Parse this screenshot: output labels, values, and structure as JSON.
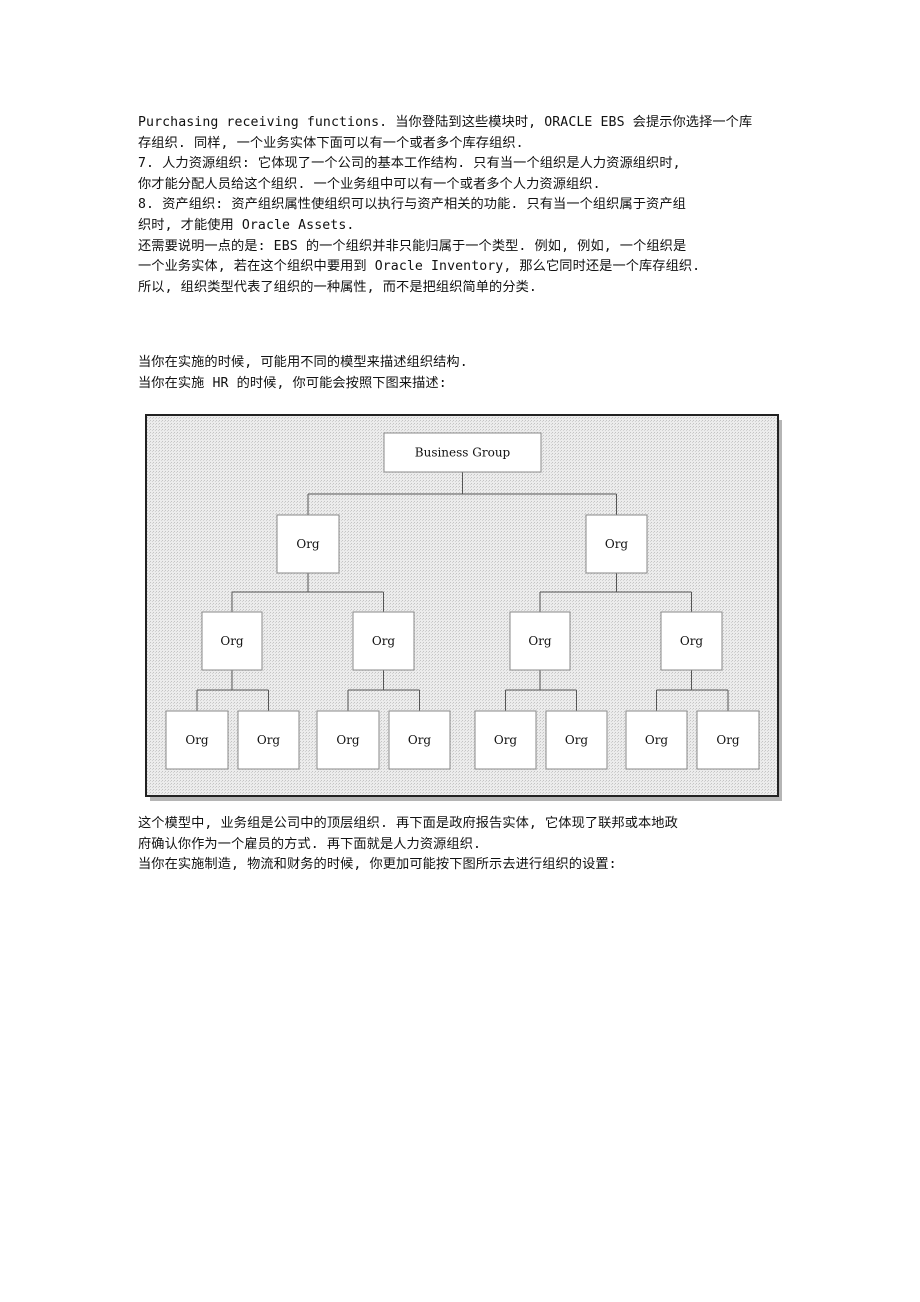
{
  "document": {
    "paragraphs_top": [
      "Purchasing receiving functions. 当你登陆到这些模块时, ORACLE EBS 会提示你选择一个库",
      "存组织. 同样, 一个业务实体下面可以有一个或者多个库存组织.",
      "7. 人力资源组织: 它体现了一个公司的基本工作结构. 只有当一个组织是人力资源组织时,",
      "你才能分配人员给这个组织. 一个业务组中可以有一个或者多个人力资源组织.",
      "8. 资产组织: 资产组织属性使组织可以执行与资产相关的功能. 只有当一个组织属于资产组",
      "织时, 才能使用 Oracle Assets.",
      "还需要说明一点的是: EBS 的一个组织并非只能归属于一个类型. 例如, 例如, 一个组织是",
      "一个业务实体, 若在这个组织中要用到 Oracle Inventory, 那么它同时还是一个库存组织.",
      "所以, 组织类型代表了组织的一种属性, 而不是把组织简单的分类."
    ],
    "paragraphs_mid": [
      "当你在实施的时候, 可能用不同的模型来描述组织结构.",
      "当你在实施 HR 的时候, 你可能会按照下图来描述:"
    ],
    "paragraphs_bottom": [
      "这个模型中, 业务组是公司中的顶层组织. 再下面是政府报告实体, 它体现了联邦或本地政",
      "府确认你作为一个雇员的方式. 再下面就是人力资源组织.",
      "当你在实施制造, 物流和财务的时候, 你更加可能按下图所示去进行组织的设置:"
    ]
  },
  "diagram": {
    "type": "org-hierarchy",
    "root": {
      "label": "Business Group",
      "children": [
        {
          "label": "Org",
          "children": [
            {
              "label": "Org",
              "children": [
                {
                  "label": "Org"
                },
                {
                  "label": "Org"
                }
              ]
            },
            {
              "label": "Org",
              "children": [
                {
                  "label": "Org"
                },
                {
                  "label": "Org"
                }
              ]
            }
          ]
        },
        {
          "label": "Org",
          "children": [
            {
              "label": "Org",
              "children": [
                {
                  "label": "Org"
                },
                {
                  "label": "Org"
                }
              ]
            },
            {
              "label": "Org",
              "children": [
                {
                  "label": "Org"
                },
                {
                  "label": "Org"
                }
              ]
            }
          ]
        }
      ]
    },
    "colors": {
      "frame": "#222222",
      "background": "#e6e6e6",
      "node_fill": "#ffffff",
      "node_border": "#8a8a8a",
      "connector": "#555555"
    }
  }
}
